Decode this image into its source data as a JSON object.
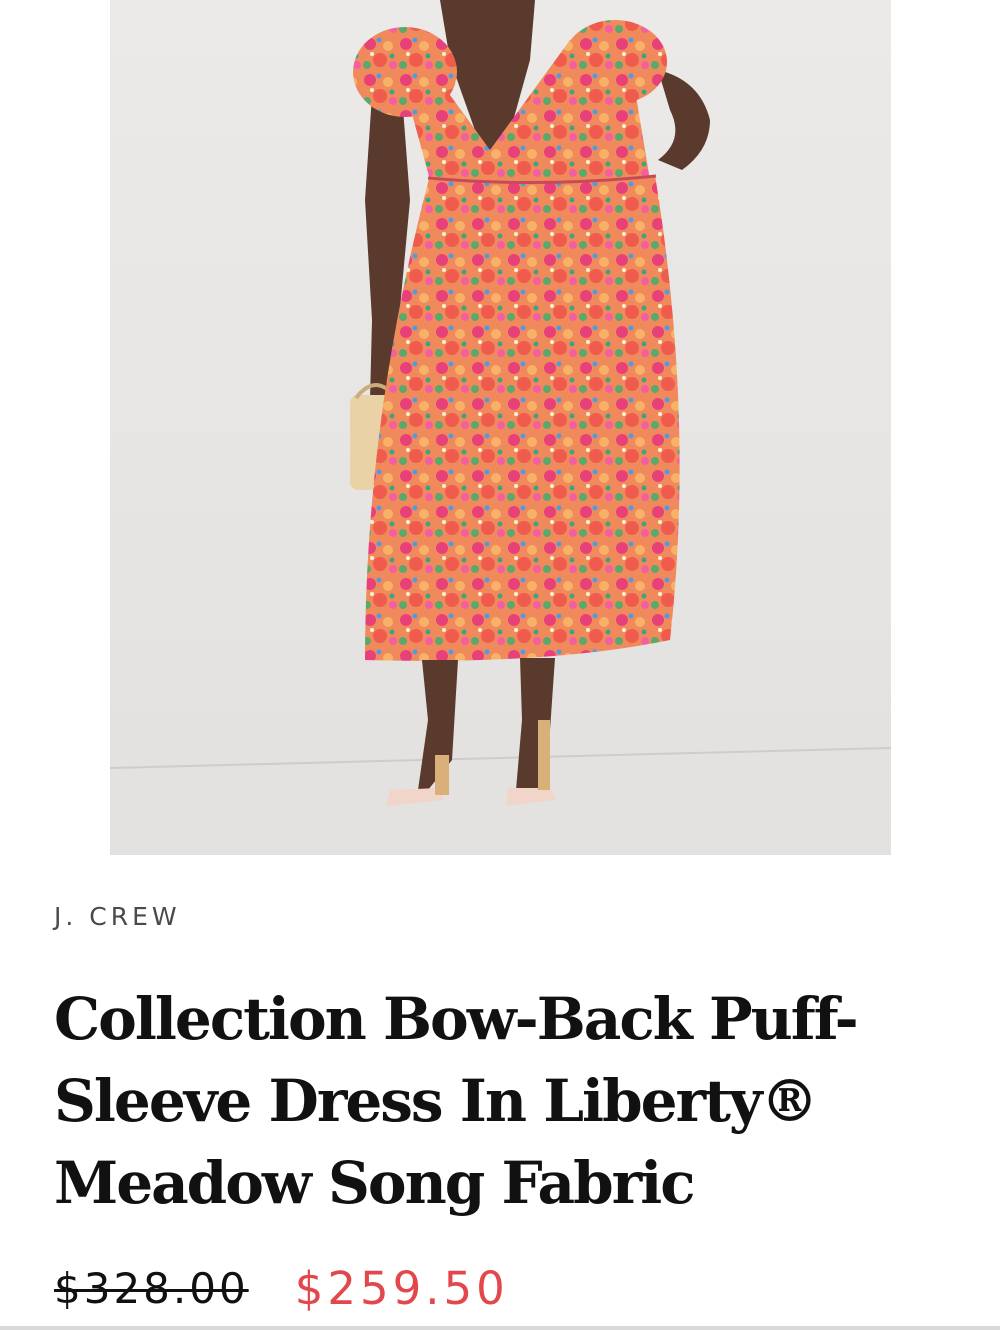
{
  "product": {
    "brand": "J. CREW",
    "title": "Collection Bow-Back Puff-Sleeve Dress In Liberty® Meadow Song Fabric",
    "price_original": "$328.00",
    "price_sale": "$259.50",
    "sale_color": "#e2474b"
  },
  "image": {
    "subject": "model wearing floral puff-sleeve midi dress"
  }
}
